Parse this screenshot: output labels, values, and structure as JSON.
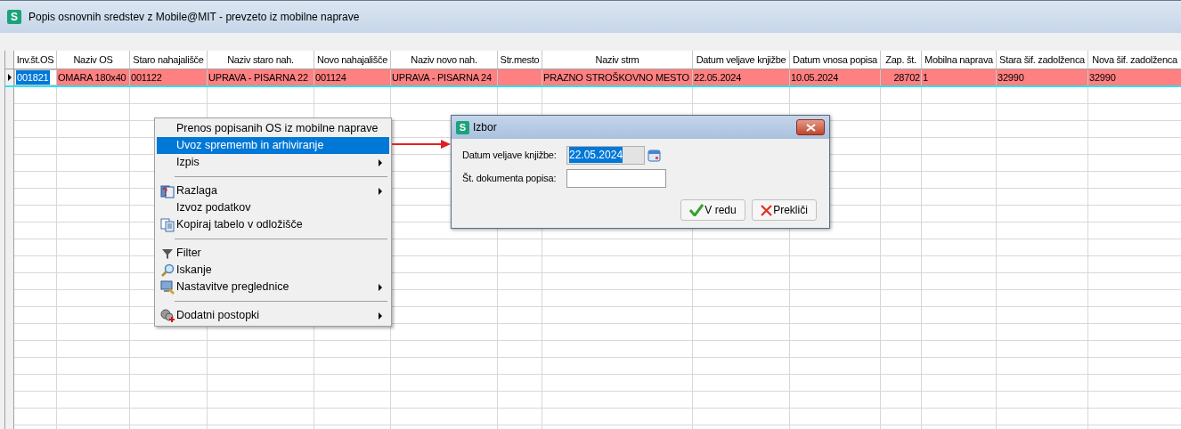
{
  "window": {
    "title": "Popis osnovnih sredstev z Mobile@MIT - prevzeto iz mobilne naprave",
    "app_icon_letter": "S"
  },
  "table": {
    "columns": [
      "Inv.št.OS",
      "Naziv OS",
      "Staro nahajališče",
      "Naziv staro nah.",
      "Novo nahajališče",
      "Naziv novo nah.",
      "Str.mesto",
      "Naziv strm",
      "Datum veljave knjižbe",
      "Datum vnosa popisa",
      "Zap. št.",
      "Mobilna naprava",
      "Stara šif. zadolženca",
      "Nova šif. zadolženca"
    ],
    "rows": [
      {
        "selected": true,
        "cells": [
          "001821",
          "OMARA 180x40",
          "001122",
          "UPRAVA - PISARNA 22",
          "001124",
          "UPRAVA - PISARNA 24",
          "",
          "PRAZNO STROŠKOVNO MESTO",
          "22.05.2024",
          "10.05.2024",
          "28702",
          "1",
          "32990",
          "32990"
        ]
      }
    ]
  },
  "context_menu": {
    "items": [
      {
        "kind": "item",
        "label": "Prenos popisanih OS iz mobilne naprave",
        "selected": false,
        "submenu": false
      },
      {
        "kind": "item",
        "label": "Uvoz sprememb in arhiviranje",
        "selected": true,
        "submenu": false
      },
      {
        "kind": "item",
        "label": "Izpis",
        "selected": false,
        "submenu": true
      },
      {
        "kind": "separator"
      },
      {
        "kind": "item",
        "label": "Razlaga",
        "selected": false,
        "submenu": true
      },
      {
        "kind": "item",
        "label": "Izvoz podatkov",
        "selected": false,
        "submenu": false
      },
      {
        "kind": "item",
        "label": "Kopiraj tabelo v odložišče",
        "selected": false,
        "submenu": false
      },
      {
        "kind": "separator"
      },
      {
        "kind": "item",
        "label": "Filter",
        "selected": false,
        "submenu": false
      },
      {
        "kind": "item",
        "label": "Iskanje",
        "selected": false,
        "submenu": false
      },
      {
        "kind": "item",
        "label": "Nastavitve preglednice",
        "selected": false,
        "submenu": true
      },
      {
        "kind": "separator"
      },
      {
        "kind": "item",
        "label": "Dodatni postopki",
        "selected": false,
        "submenu": true
      }
    ]
  },
  "dialog": {
    "title": "Izbor",
    "app_icon_letter": "S",
    "fields": [
      {
        "label": "Datum veljave knjižbe:",
        "value": "22.05.2024",
        "disabled": true,
        "calendar": true
      },
      {
        "label": "Št. dokumenta popisa:",
        "disabled": false,
        "calendar": false
      }
    ],
    "buttons": [
      {
        "kind": "ok",
        "label": "V redu"
      },
      {
        "kind": "cancel",
        "label": "Prekliči"
      }
    ]
  }
}
